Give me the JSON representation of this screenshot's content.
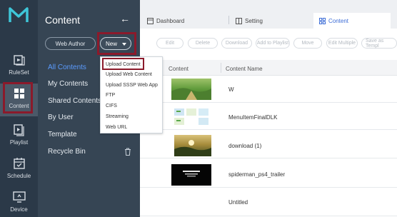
{
  "rail": {
    "items": [
      {
        "label": "RuleSet",
        "icon": "ruleset-icon"
      },
      {
        "label": "Content",
        "icon": "content-grid-icon",
        "active": true
      },
      {
        "label": "Playlist",
        "icon": "playlist-icon"
      },
      {
        "label": "Schedule",
        "icon": "schedule-icon"
      },
      {
        "label": "Device",
        "icon": "device-icon"
      }
    ]
  },
  "panel": {
    "title": "Content",
    "back_icon": "arrow-left-icon",
    "web_author_label": "Web Author",
    "new_label": "New",
    "nav": [
      {
        "label": "All Contents",
        "active": true
      },
      {
        "label": "My Contents"
      },
      {
        "label": "Shared Contents"
      },
      {
        "label": "By User"
      },
      {
        "label": "Template"
      },
      {
        "label": "Recycle Bin"
      }
    ]
  },
  "dropdown": {
    "items": [
      "Upload Content",
      "Upload Web Content",
      "Upload SSSP Web App",
      "FTP",
      "CIFS",
      "Streaming",
      "Web URL"
    ]
  },
  "tabs": [
    {
      "label": "Dashboard",
      "icon": "dashboard-icon"
    },
    {
      "label": "Setting",
      "icon": "setting-icon"
    },
    {
      "label": "Content",
      "icon": "content-tab-icon",
      "active": true
    }
  ],
  "toolbar": {
    "buttons": [
      "Edit",
      "Delete",
      "Download",
      "Add to Playlist",
      "Move",
      "Edit Multiple",
      "Save as Templ"
    ]
  },
  "table": {
    "columns": [
      "Content",
      "Content Name"
    ],
    "rows": [
      {
        "name": "W"
      },
      {
        "name": "MenuItemFinalDLK"
      },
      {
        "name": "download (1)"
      },
      {
        "name": "spiderman_ps4_trailer"
      },
      {
        "name": "Untitled"
      }
    ]
  },
  "colors": {
    "rail_bg": "#2b3948",
    "panel_bg": "#364554",
    "accent": "#3a6bd6",
    "highlight_box": "#8b1a2b"
  }
}
